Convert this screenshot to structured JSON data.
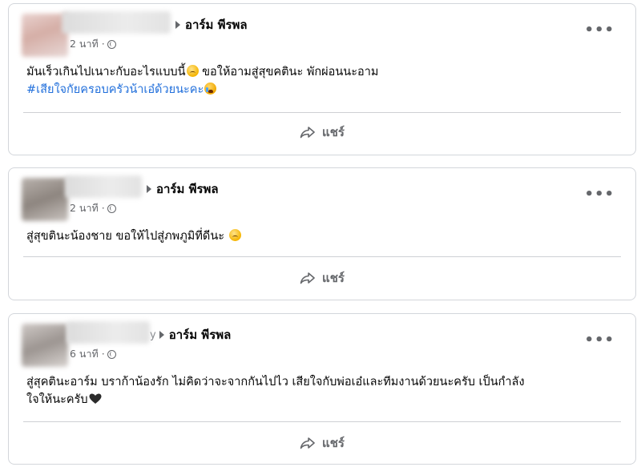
{
  "posts": [
    {
      "author": "อาร์ม พีรพล",
      "author_tail": "",
      "timestamp": "2 นาที ·",
      "text_lines": [
        "มันเร็วเกินไปเนาะกับอะไรแบบนี้",
        " ขอให้อามสู่สุขคตินะ พักผ่อนนะอาม"
      ],
      "hashtag": "#เสียใจกัยครอบครัวน้าเอ๋ด้วยนะคะ",
      "emojis": [
        "sad-face-icon",
        "crying-face-icon"
      ],
      "more_label": "•••",
      "share_label": "แชร์"
    },
    {
      "author": "อาร์ม พีรพล",
      "author_tail": "",
      "timestamp": "2 นาที ·",
      "text": "สู่สุขตินะน้องชาย ขอให้ไปสู่ภพภูมิที่ดีนะ",
      "emojis": [
        "sad-face-icon"
      ],
      "more_label": "•••",
      "share_label": "แชร์"
    },
    {
      "author": "อาร์ม พีรพล",
      "author_tail": "y",
      "timestamp": "6 นาที ·",
      "text_line1": "สู่สุคตินะอาร์ม บราก้าน้องรัก  ไม่คิดว่าจะจากกันไปไว เสียใจกับพ่อเอ๋และทีมงานด้วยนะครับ เป็นกำลัง",
      "text_line2": "ใจให้นะครับ",
      "emojis": [
        "black-heart-icon"
      ],
      "more_label": "•••",
      "share_label": "แชร์"
    }
  ],
  "colors": {
    "hashtag": "#216fdb",
    "meta": "#65676b",
    "border": "#d3d6db"
  }
}
